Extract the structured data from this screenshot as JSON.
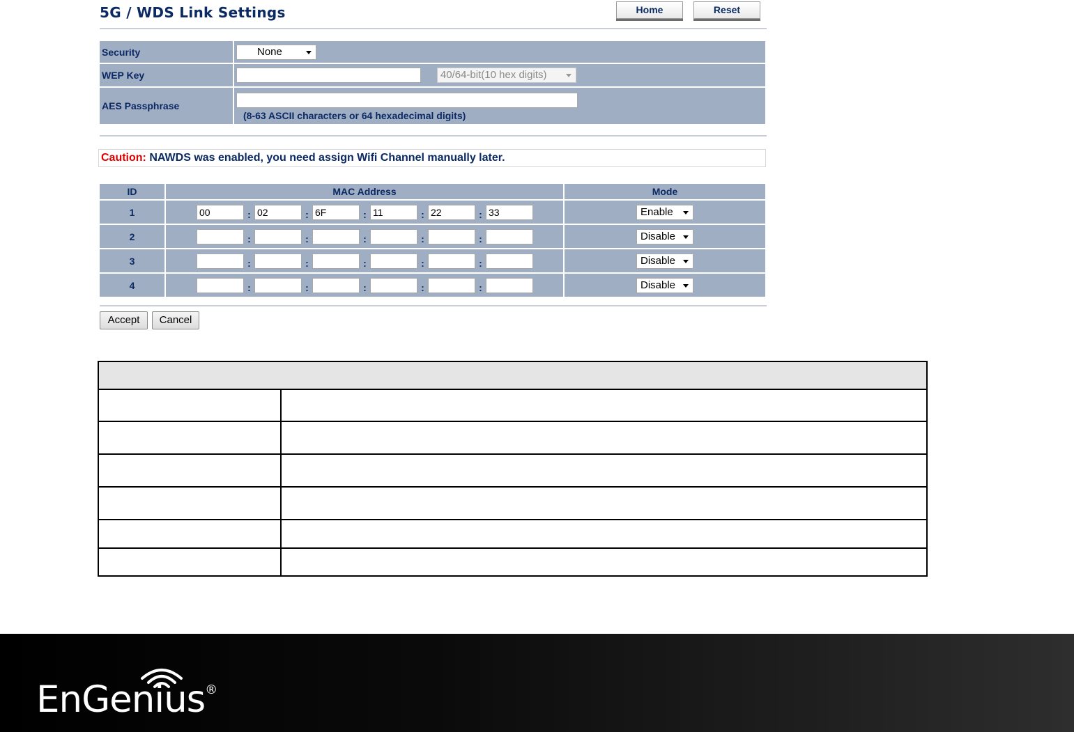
{
  "header": {
    "title": "5G / WDS Link Settings",
    "home_label": "Home",
    "reset_label": "Reset"
  },
  "security": {
    "security_label": "Security",
    "security_value": "None",
    "wep_label": "WEP Key",
    "wep_value": "",
    "wep_format": "40/64-bit(10 hex digits)",
    "aes_label": "AES Passphrase",
    "aes_value": "",
    "aes_hint": "(8-63 ASCII characters or 64 hexadecimal digits)"
  },
  "caution": {
    "label": "Caution:",
    "message": "NAWDS was enabled, you need assign Wifi Channel manually later."
  },
  "wds": {
    "headers": {
      "id": "ID",
      "mac": "MAC Address",
      "mode": "Mode"
    },
    "rows": [
      {
        "id": "1",
        "mac": [
          "00",
          "02",
          "6F",
          "11",
          "22",
          "33"
        ],
        "mode": "Enable"
      },
      {
        "id": "2",
        "mac": [
          "",
          "",
          "",
          "",
          "",
          ""
        ],
        "mode": "Disable"
      },
      {
        "id": "3",
        "mac": [
          "",
          "",
          "",
          "",
          "",
          ""
        ],
        "mode": "Disable"
      },
      {
        "id": "4",
        "mac": [
          "",
          "",
          "",
          "",
          "",
          ""
        ],
        "mode": "Disable"
      }
    ],
    "separator": ":"
  },
  "actions": {
    "accept_label": "Accept",
    "cancel_label": "Cancel"
  },
  "footer": {
    "logo_text": "EnGenius",
    "logo_mark": "®"
  },
  "colors": {
    "table_bg": "#a0aec4",
    "text_navy": "#0b2a63",
    "caution_red": "#e10000"
  }
}
